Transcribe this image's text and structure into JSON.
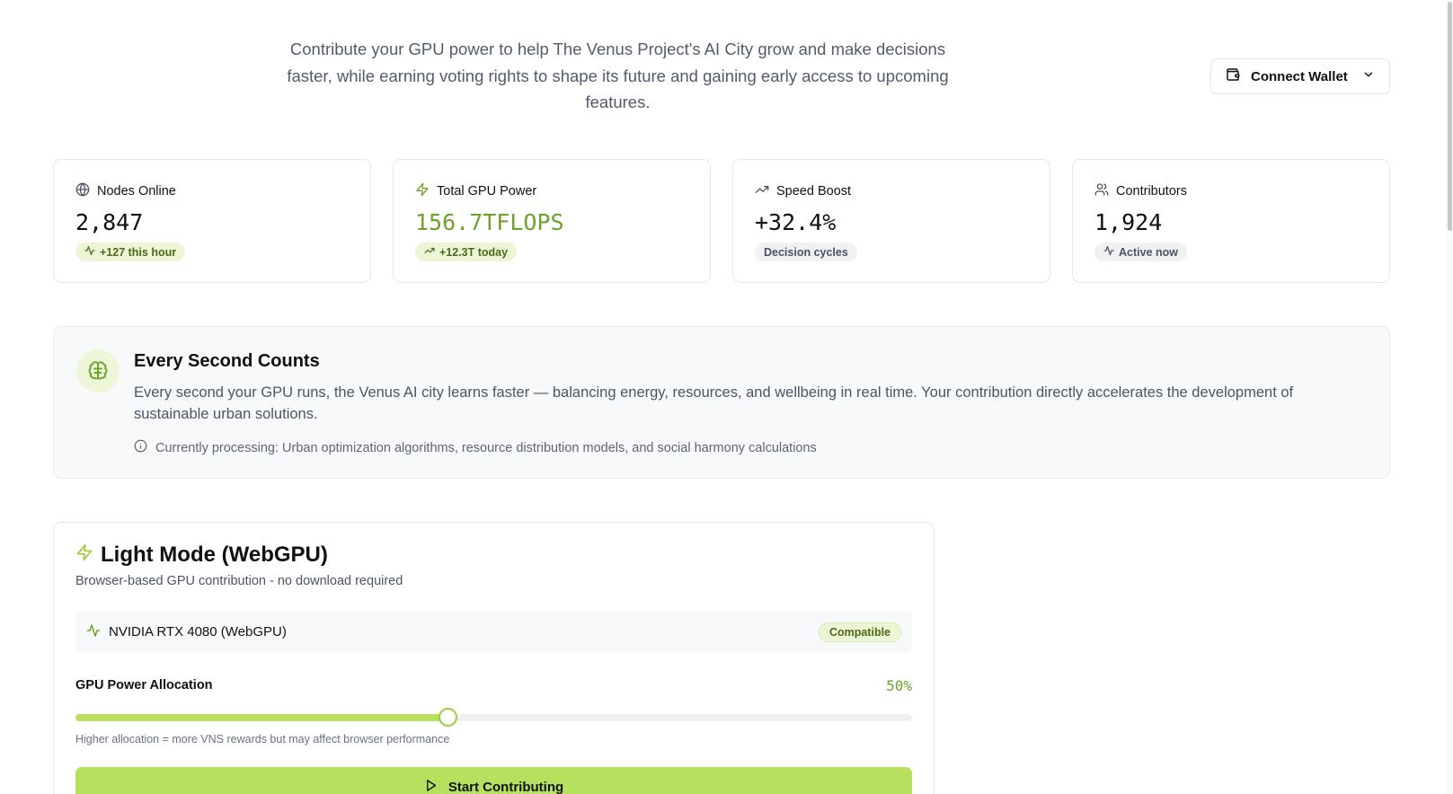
{
  "intro": {
    "text": "Contribute your GPU power to help The Venus Project's AI City grow and make decisions faster, while earning voting rights to shape its future and gaining early access to upcoming features."
  },
  "wallet": {
    "label": "Connect Wallet",
    "icon": "wallet-icon"
  },
  "stats": [
    {
      "title": "Nodes Online",
      "value": "2,847",
      "badge": "+127 this hour",
      "badge_style": "green",
      "icon": "globe-icon"
    },
    {
      "title": "Total GPU Power",
      "value": "156.7TFLOPS",
      "badge": "+12.3T today",
      "badge_style": "green",
      "icon": "bolt-icon"
    },
    {
      "title": "Speed Boost",
      "value": "+32.4%",
      "badge": "Decision cycles",
      "badge_style": "gray",
      "icon": "trending-up-icon"
    },
    {
      "title": "Contributors",
      "value": "1,924",
      "badge": "Active now",
      "badge_style": "gray",
      "icon": "users-icon"
    }
  ],
  "info": {
    "title": "Every Second Counts",
    "body": "Every second your GPU runs, the Venus AI city learns faster — balancing energy, resources, and wellbeing in real time. Your contribution directly accelerates the development of sustainable urban solutions.",
    "note": "Currently processing: Urban optimization algorithms, resource distribution models, and social harmony calculations"
  },
  "mode": {
    "title": "Light Mode (WebGPU)",
    "subtitle": "Browser-based GPU contribution - no download required",
    "gpu_name": "NVIDIA RTX 4080 (WebGPU)",
    "compat": "Compatible",
    "alloc_label": "GPU Power Allocation",
    "alloc_value": "50%",
    "alloc_fraction": 0.445,
    "alloc_hint": "Higher allocation = more VNS rewards but may affect browser performance",
    "start_label": "Start Contributing"
  },
  "colors": {
    "accent": "#b6e05d",
    "accent_text": "#6fa12c",
    "badge_bg": "#ecf6d6"
  }
}
